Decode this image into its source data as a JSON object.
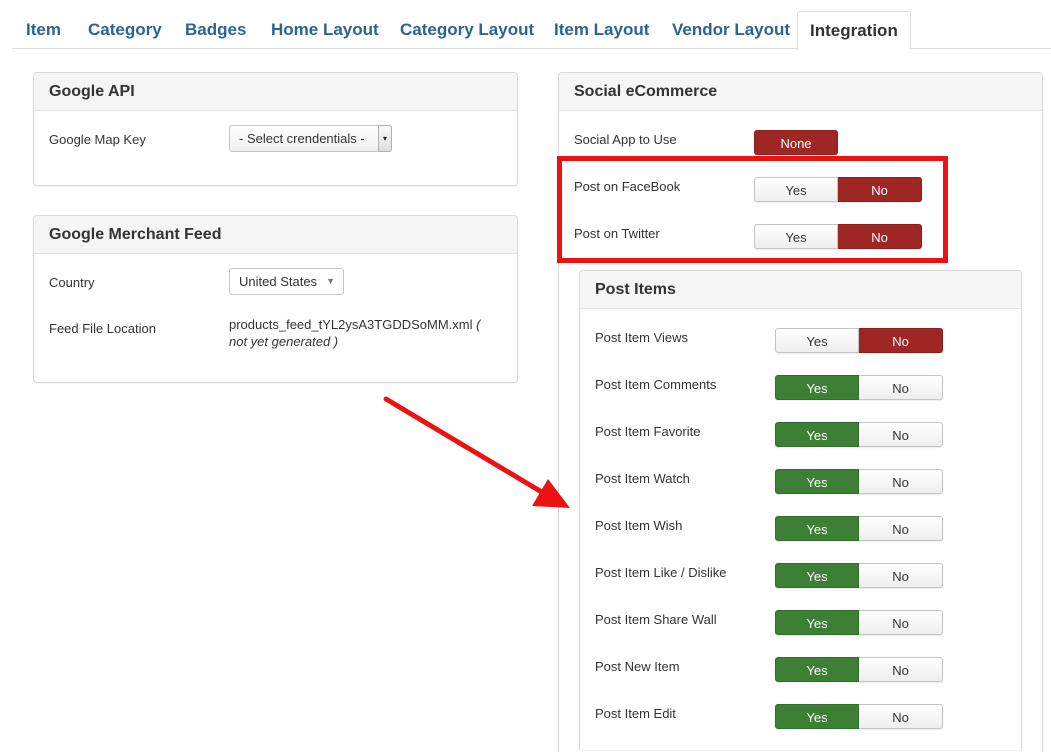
{
  "tabs": [
    {
      "label": "Item"
    },
    {
      "label": "Category"
    },
    {
      "label": "Badges"
    },
    {
      "label": "Home Layout"
    },
    {
      "label": "Category Layout"
    },
    {
      "label": "Item Layout"
    },
    {
      "label": "Vendor Layout"
    },
    {
      "label": "Integration",
      "active": true
    }
  ],
  "google_api": {
    "title": "Google API",
    "map_key_label": "Google Map Key",
    "map_key_value": "- Select crendentials -"
  },
  "merchant_feed": {
    "title": "Google Merchant Feed",
    "country_label": "Country",
    "country_value": "United States",
    "feed_label": "Feed File Location",
    "feed_file": "products_feed_tYL2ysA3TGDDSoMM.xml",
    "feed_status": "( not yet generated )"
  },
  "social": {
    "title": "Social eCommerce",
    "app_label": "Social App to Use",
    "app_value": "None",
    "facebook": {
      "label": "Post on FaceBook",
      "yes": "Yes",
      "no": "No",
      "value": "No"
    },
    "twitter": {
      "label": "Post on Twitter",
      "yes": "Yes",
      "no": "No",
      "value": "No"
    }
  },
  "post_items": {
    "title": "Post Items",
    "rows": [
      {
        "label": "Post Item Views",
        "yes": "Yes",
        "no": "No",
        "value": "No"
      },
      {
        "label": "Post Item Comments",
        "yes": "Yes",
        "no": "No",
        "value": "Yes"
      },
      {
        "label": "Post Item Favorite",
        "yes": "Yes",
        "no": "No",
        "value": "Yes"
      },
      {
        "label": "Post Item Watch",
        "yes": "Yes",
        "no": "No",
        "value": "Yes"
      },
      {
        "label": "Post Item Wish",
        "yes": "Yes",
        "no": "No",
        "value": "Yes"
      },
      {
        "label": "Post Item Like / Dislike",
        "yes": "Yes",
        "no": "No",
        "value": "Yes"
      },
      {
        "label": "Post Item Share Wall",
        "yes": "Yes",
        "no": "No",
        "value": "Yes"
      },
      {
        "label": "Post New Item",
        "yes": "Yes",
        "no": "No",
        "value": "Yes"
      },
      {
        "label": "Post Item Edit",
        "yes": "Yes",
        "no": "No",
        "value": "Yes"
      }
    ]
  },
  "colors": {
    "link": "#2a6496",
    "toggle_no_active": "#9e2623",
    "toggle_yes_active": "#3d7f34",
    "annotation": "#ee1111"
  }
}
